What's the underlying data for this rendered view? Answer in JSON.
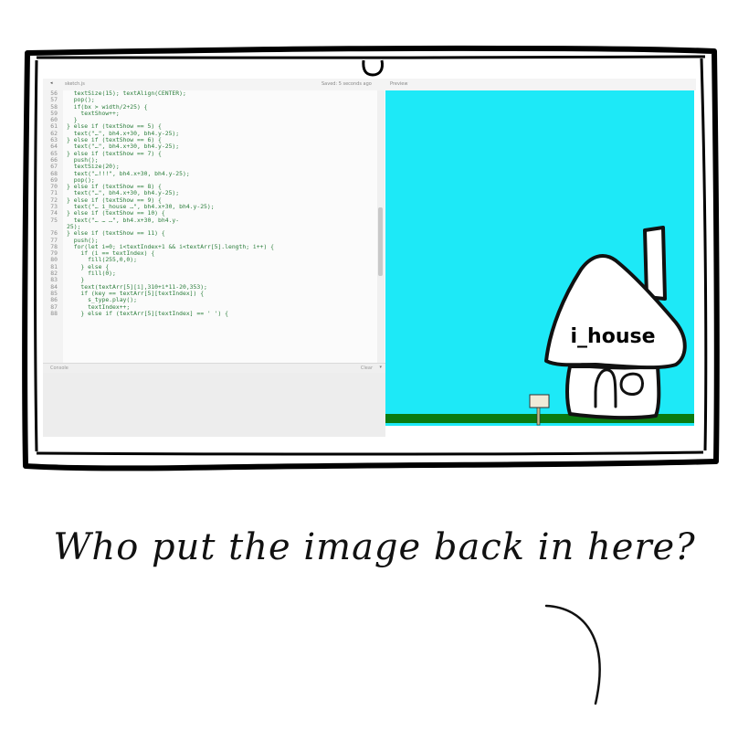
{
  "tabbar": {
    "collapse_icon": "chevron-left-icon",
    "sketch_label": "sketch.js",
    "saved_label": "Saved: 5 seconds ago",
    "preview_label": "Preview"
  },
  "editor": {
    "lines": [
      {
        "n": "56",
        "t": "  textSize(15); textAlign(CENTER);"
      },
      {
        "n": "57",
        "t": "  pop();"
      },
      {
        "n": "58",
        "t": "  if(bx > width/2+25) {"
      },
      {
        "n": "59",
        "t": "    textShow++;"
      },
      {
        "n": "60",
        "t": "  }"
      },
      {
        "n": "61",
        "t": "} else if (textShow == 5) {"
      },
      {
        "n": "62",
        "t": "  text(\"…\", bh4.x+30, bh4.y-25);"
      },
      {
        "n": "63",
        "t": "} else if (textShow == 6) {"
      },
      {
        "n": "64",
        "t": "  text(\"…\", bh4.x+30, bh4.y-25);"
      },
      {
        "n": "65",
        "t": "} else if (textShow == 7) {"
      },
      {
        "n": "66",
        "t": "  push();"
      },
      {
        "n": "67",
        "t": "  textSize(20);"
      },
      {
        "n": "68",
        "t": "  text(\"…!!!\", bh4.x+30, bh4.y-25);"
      },
      {
        "n": "69",
        "t": "  pop();"
      },
      {
        "n": "70",
        "t": "} else if (textShow == 8) {"
      },
      {
        "n": "71",
        "t": "  text(\"…\", bh4.x+30, bh4.y-25);"
      },
      {
        "n": "72",
        "t": "} else if (textShow == 9) {"
      },
      {
        "n": "73",
        "t": "  text(\"… i_house …\", bh4.x+30, bh4.y-25);"
      },
      {
        "n": "74",
        "t": "} else if (textShow == 10) {"
      },
      {
        "n": "75",
        "t": "  text(\"… … …\", bh4.x+30, bh4.y-"
      },
      {
        "n": "",
        "t": "25);"
      },
      {
        "n": "76",
        "t": "} else if (textShow == 11) {"
      },
      {
        "n": "77",
        "t": "  push();"
      },
      {
        "n": "78",
        "t": "  for(let i=0; i<textIndex+1 && i<textArr[5].length; i++) {"
      },
      {
        "n": "79",
        "t": "    if (i == textIndex) {"
      },
      {
        "n": "80",
        "t": "      fill(255,0,0);"
      },
      {
        "n": "81",
        "t": "    } else {"
      },
      {
        "n": "82",
        "t": "      fill(0);"
      },
      {
        "n": "83",
        "t": "    }"
      },
      {
        "n": "84",
        "t": "    text(textArr[5][i],310+i*11-20,353);"
      },
      {
        "n": "85",
        "t": "    if (key == textArr[5][textIndex]) {"
      },
      {
        "n": "86",
        "t": "      s_type.play();"
      },
      {
        "n": "87",
        "t": "      textIndex++;"
      },
      {
        "n": "88",
        "t": "    } else if (textArr[5][textIndex] == ' ') {"
      }
    ]
  },
  "console": {
    "label": "Console",
    "clear_label": "Clear",
    "chevron_icon": "chevron-down-icon"
  },
  "canvas": {
    "house_label": "i_house",
    "sky_color": "#1de9f7",
    "ground_color": "#0b7a10",
    "sign_icon": "signpost-icon",
    "house_icon": "house-icon"
  },
  "caption": "Who put the image back in here?"
}
